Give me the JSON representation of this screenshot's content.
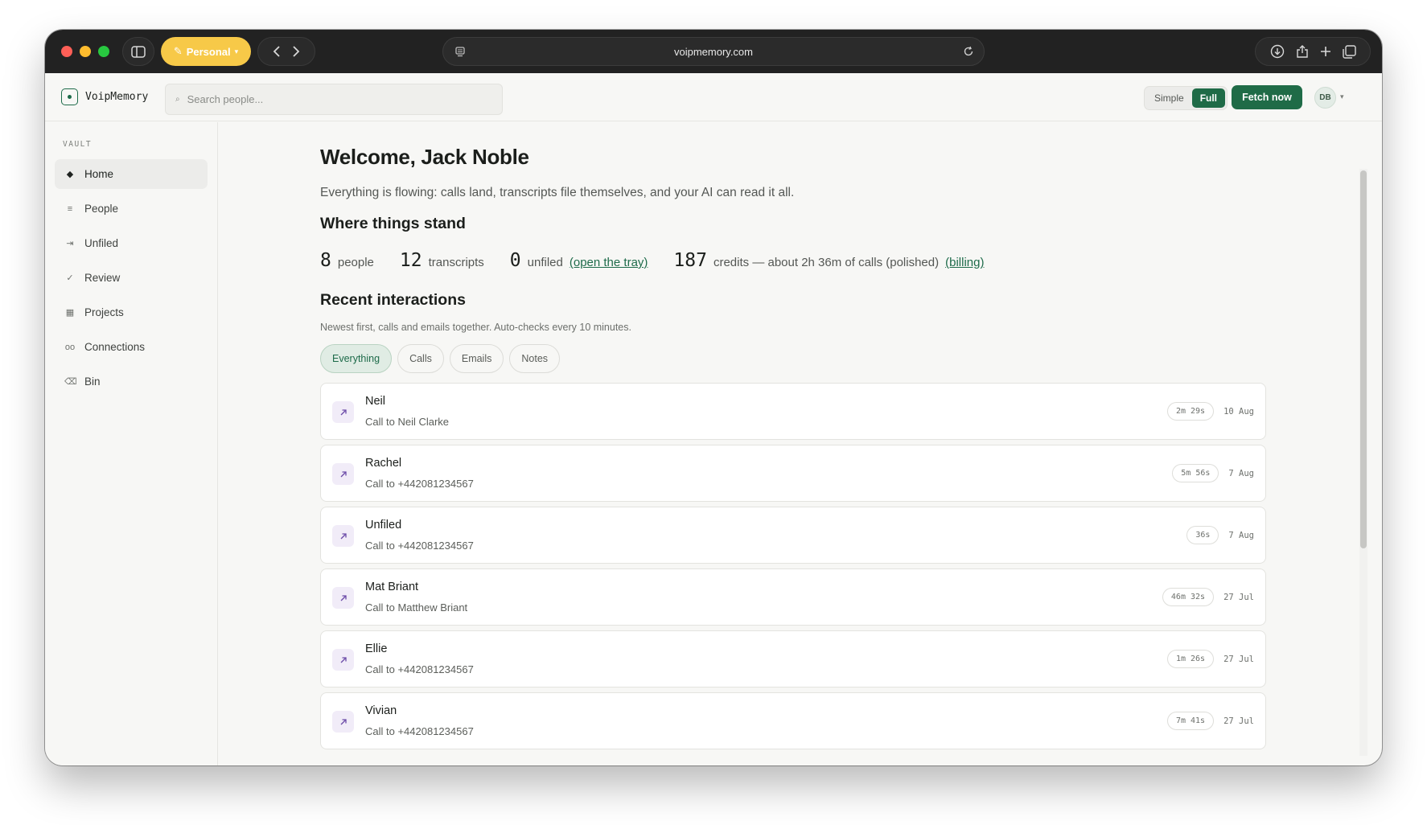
{
  "browser": {
    "profile_label": "Personal",
    "url": "voipmemory.com"
  },
  "header": {
    "app_name": "VoipMemory",
    "search_placeholder": "Search people...",
    "mode_simple": "Simple",
    "mode_full": "Full",
    "mode_selected": "Full",
    "fetch_label": "Fetch now",
    "avatar_initials": "DB"
  },
  "sidebar": {
    "section_label": "VAULT",
    "items": [
      {
        "label": "Home",
        "icon": "diamond-icon",
        "glyph": "◆",
        "active": true
      },
      {
        "label": "People",
        "icon": "list-icon",
        "glyph": "≡",
        "active": false
      },
      {
        "label": "Unfiled",
        "icon": "arrow-tray-icon",
        "glyph": "⇥",
        "active": false
      },
      {
        "label": "Review",
        "icon": "check-icon",
        "glyph": "✓",
        "active": false
      },
      {
        "label": "Projects",
        "icon": "grid-icon",
        "glyph": "▦",
        "active": false
      },
      {
        "label": "Connections",
        "icon": "link-icon",
        "glyph": "oo",
        "active": false
      },
      {
        "label": "Bin",
        "icon": "bin-icon",
        "glyph": "⌫",
        "active": false
      }
    ]
  },
  "main": {
    "welcome": "Welcome, Jack Noble",
    "subtitle": "Everything is flowing: calls land, transcripts file themselves, and your AI can read it all.",
    "stats_heading": "Where things stand",
    "stats": {
      "people_count": "8",
      "people_label": "people",
      "transcripts_count": "12",
      "transcripts_label": "transcripts",
      "unfiled_count": "0",
      "unfiled_label": "unfiled",
      "unfiled_link": "(open the tray)",
      "credits_count": "187",
      "credits_label": "credits — about 2h 36m of calls (polished)",
      "credits_link": "(billing)"
    },
    "recent_heading": "Recent interactions",
    "recent_hint": "Newest first, calls and emails together. Auto-checks every 10 minutes.",
    "filters": [
      "Everything",
      "Calls",
      "Emails",
      "Notes"
    ],
    "active_filter": "Everything",
    "interactions": [
      {
        "title": "Neil",
        "subtitle": "Call to Neil Clarke",
        "duration": "2m 29s",
        "date": "10 Aug",
        "icon": "outgoing-call-icon"
      },
      {
        "title": "Rachel",
        "subtitle": "Call to +442081234567",
        "duration": "5m 56s",
        "date": "7 Aug",
        "icon": "outgoing-call-icon"
      },
      {
        "title": "Unfiled",
        "subtitle": "Call to +442081234567",
        "duration": "36s",
        "date": "7 Aug",
        "icon": "outgoing-call-icon"
      },
      {
        "title": "Mat Briant",
        "subtitle": "Call to Matthew Briant",
        "duration": "46m 32s",
        "date": "27 Jul",
        "icon": "outgoing-call-icon"
      },
      {
        "title": "Ellie",
        "subtitle": "Call to +442081234567",
        "duration": "1m 26s",
        "date": "27 Jul",
        "icon": "outgoing-call-icon"
      },
      {
        "title": "Vivian",
        "subtitle": "Call to +442081234567",
        "duration": "7m 41s",
        "date": "27 Jul",
        "icon": "outgoing-call-icon"
      }
    ]
  },
  "colors": {
    "accent": "#1f6b47",
    "profile_pill": "#f7c948",
    "call_icon_bg": "#f1ecf8"
  }
}
